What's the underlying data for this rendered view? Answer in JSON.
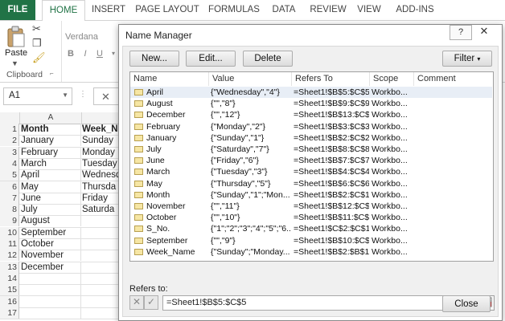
{
  "ribbon": {
    "tabs": [
      "FILE",
      "HOME",
      "INSERT",
      "PAGE LAYOUT",
      "FORMULAS",
      "DATA",
      "REVIEW",
      "VIEW",
      "ADD-INS"
    ],
    "paste_label": "Paste",
    "clipboard_label": "Clipboard",
    "font_name": "Verdana",
    "bold": "B",
    "italic": "I",
    "underline": "U"
  },
  "formula_bar": {
    "name_box": "A1",
    "cancel_glyph": "✕"
  },
  "sheet": {
    "columns": [
      "A"
    ],
    "header_row": {
      "a": "Month",
      "b": "Week_N"
    },
    "rows": [
      {
        "num": "1",
        "a": "Month",
        "b": "Week_N"
      },
      {
        "num": "2",
        "a": "January",
        "b": "Sunday"
      },
      {
        "num": "3",
        "a": "February",
        "b": "Monday"
      },
      {
        "num": "4",
        "a": "March",
        "b": "Tuesday"
      },
      {
        "num": "5",
        "a": "April",
        "b": "Wednesd"
      },
      {
        "num": "6",
        "a": "May",
        "b": "Thursda"
      },
      {
        "num": "7",
        "a": "June",
        "b": "Friday"
      },
      {
        "num": "8",
        "a": "July",
        "b": "Saturda"
      },
      {
        "num": "9",
        "a": "August",
        "b": ""
      },
      {
        "num": "10",
        "a": "September",
        "b": ""
      },
      {
        "num": "11",
        "a": "October",
        "b": ""
      },
      {
        "num": "12",
        "a": "November",
        "b": ""
      },
      {
        "num": "13",
        "a": "December",
        "b": ""
      },
      {
        "num": "14",
        "a": "",
        "b": ""
      },
      {
        "num": "15",
        "a": "",
        "b": ""
      },
      {
        "num": "16",
        "a": "",
        "b": ""
      },
      {
        "num": "17",
        "a": "",
        "b": ""
      }
    ]
  },
  "dialog": {
    "title": "Name Manager",
    "help": "?",
    "close_glyph": "✕",
    "buttons": {
      "new": "New...",
      "edit": "Edit...",
      "delete": "Delete",
      "filter": "Filter"
    },
    "columns": [
      "Name",
      "Value",
      "Refers To",
      "Scope",
      "Comment"
    ],
    "names": [
      {
        "name": "April",
        "value": "{\"Wednesday\",\"4\"}",
        "refers": "=Sheet1!$B$5:$C$5",
        "scope": "Workbo...",
        "comment": ""
      },
      {
        "name": "August",
        "value": "{\"\",\"8\"}",
        "refers": "=Sheet1!$B$9:$C$9",
        "scope": "Workbo...",
        "comment": ""
      },
      {
        "name": "December",
        "value": "{\"\",\"12\"}",
        "refers": "=Sheet1!$B$13:$C$...",
        "scope": "Workbo...",
        "comment": ""
      },
      {
        "name": "February",
        "value": "{\"Monday\",\"2\"}",
        "refers": "=Sheet1!$B$3:$C$3",
        "scope": "Workbo...",
        "comment": ""
      },
      {
        "name": "January",
        "value": "{\"Sunday\",\"1\"}",
        "refers": "=Sheet1!$B$2:$C$2",
        "scope": "Workbo...",
        "comment": ""
      },
      {
        "name": "July",
        "value": "{\"Saturday\",\"7\"}",
        "refers": "=Sheet1!$B$8:$C$8",
        "scope": "Workbo...",
        "comment": ""
      },
      {
        "name": "June",
        "value": "{\"Friday\",\"6\"}",
        "refers": "=Sheet1!$B$7:$C$7",
        "scope": "Workbo...",
        "comment": ""
      },
      {
        "name": "March",
        "value": "{\"Tuesday\",\"3\"}",
        "refers": "=Sheet1!$B$4:$C$4",
        "scope": "Workbo...",
        "comment": ""
      },
      {
        "name": "May",
        "value": "{\"Thursday\",\"5\"}",
        "refers": "=Sheet1!$B$6:$C$6",
        "scope": "Workbo...",
        "comment": ""
      },
      {
        "name": "Month",
        "value": "{\"Sunday\",\"1\";\"Mon...",
        "refers": "=Sheet1!$B$2:$C$13",
        "scope": "Workbo...",
        "comment": ""
      },
      {
        "name": "November",
        "value": "{\"\",\"11\"}",
        "refers": "=Sheet1!$B$12:$C$...",
        "scope": "Workbo...",
        "comment": ""
      },
      {
        "name": "October",
        "value": "{\"\",\"10\"}",
        "refers": "=Sheet1!$B$11:$C$...",
        "scope": "Workbo...",
        "comment": ""
      },
      {
        "name": "S_No.",
        "value": "{\"1\";\"2\";\"3\";\"4\";\"5\";\"6...",
        "refers": "=Sheet1!$C$2:$C$13",
        "scope": "Workbo...",
        "comment": ""
      },
      {
        "name": "September",
        "value": "{\"\",\"9\"}",
        "refers": "=Sheet1!$B$10:$C$...",
        "scope": "Workbo...",
        "comment": ""
      },
      {
        "name": "Week_Name",
        "value": "{\"Sunday\";\"Monday...",
        "refers": "=Sheet1!$B$2:$B$13",
        "scope": "Workbo...",
        "comment": ""
      }
    ],
    "refers_to_label": "Refers to:",
    "refers_to_value": "=Sheet1!$B$5:$C$5",
    "close_button": "Close"
  },
  "colors": {
    "excel_green": "#217346",
    "selection": "#e8eef6"
  }
}
